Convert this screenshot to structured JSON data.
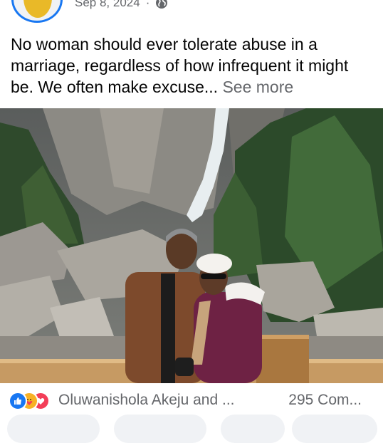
{
  "post": {
    "date": "Sep 8, 2024",
    "separator": "·",
    "visibility_icon": "globe-icon",
    "text": "No woman should ever tolerate abuse in a marriage, regardless of how infrequent it might be. We often make excuse",
    "ellipsis": "...",
    "see_more": "See more"
  },
  "photo": {
    "description_icon": "photo"
  },
  "reactions": {
    "icons": [
      "like-icon",
      "care-icon",
      "love-icon"
    ],
    "reacted_by": "Oluwanishola Akeju and ...",
    "comments": "295 Com..."
  },
  "colors": {
    "brand": "#1877f2",
    "secondary_text": "#65676b",
    "like": "#1877f2",
    "care": "#f7b125",
    "love": "#f33e58"
  }
}
